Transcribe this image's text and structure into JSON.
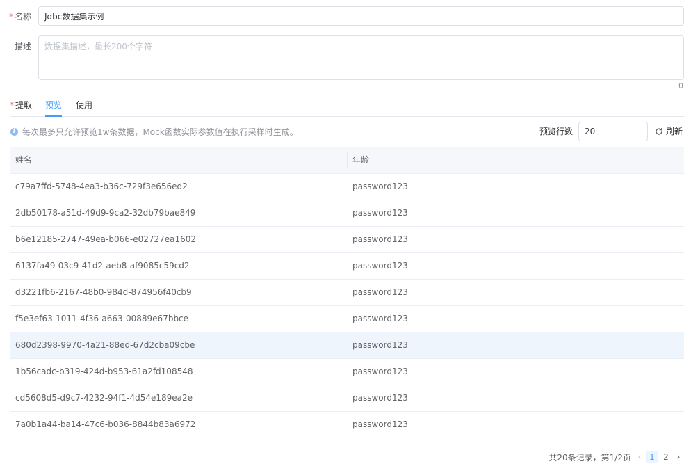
{
  "form": {
    "name_label": "名称",
    "name_value": "Jdbc数据集示例",
    "desc_label": "描述",
    "desc_placeholder": "数据集描述，最长200个字符",
    "desc_counter": "0"
  },
  "tabs": {
    "extract": "提取",
    "preview": "预览",
    "use": "使用"
  },
  "preview": {
    "info_text": "每次最多只允许预览1w条数据，Mock函数实际参数值在执行采样时生成。",
    "rows_label": "预览行数",
    "rows_value": "20",
    "refresh_label": "刷新"
  },
  "table": {
    "columns": [
      "姓名",
      "年龄"
    ],
    "rows": [
      [
        "c79a7ffd-5748-4ea3-b36c-729f3e656ed2",
        "password123"
      ],
      [
        "2db50178-a51d-49d9-9ca2-32db79bae849",
        "password123"
      ],
      [
        "b6e12185-2747-49ea-b066-e02727ea1602",
        "password123"
      ],
      [
        "6137fa49-03c9-41d2-aeb8-af9085c59cd2",
        "password123"
      ],
      [
        "d3221fb6-2167-48b0-984d-874956f40cb9",
        "password123"
      ],
      [
        "f5e3ef63-1011-4f36-a663-00889e67bbce",
        "password123"
      ],
      [
        "680d2398-9970-4a21-88ed-67d2cba09cbe",
        "password123"
      ],
      [
        "1b56cadc-b319-424d-b953-61a2fd108548",
        "password123"
      ],
      [
        "cd5608d5-d9c7-4232-94f1-4d54e189ea2e",
        "password123"
      ],
      [
        "7a0b1a44-ba14-47c6-b036-8844b83a6972",
        "password123"
      ]
    ]
  },
  "pagination": {
    "summary": "共20条记录，第1/2页",
    "pages": [
      "1",
      "2"
    ],
    "prev_icon": "‹",
    "next_icon": "›"
  },
  "colors": {
    "accent": "#409eff",
    "required": "#f56c6c"
  }
}
